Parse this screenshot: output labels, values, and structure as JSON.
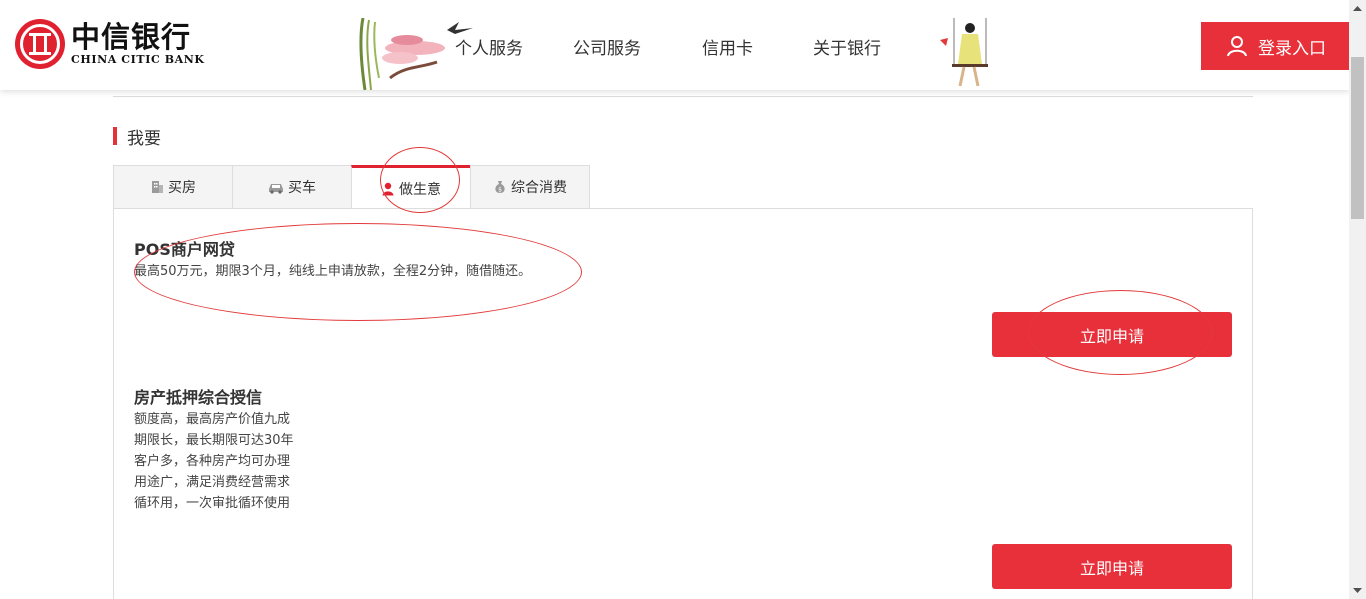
{
  "header": {
    "logo": {
      "cn": "中信银行",
      "en": "CHINA CITIC BANK"
    },
    "nav": [
      "个人服务",
      "公司服务",
      "信用卡",
      "关于银行"
    ],
    "login_label": "登录入口"
  },
  "section": {
    "title": "我要"
  },
  "tabs": [
    {
      "label": "买房",
      "icon": "building-icon"
    },
    {
      "label": "买车",
      "icon": "car-icon"
    },
    {
      "label": "做生意",
      "icon": "person-icon",
      "active": true
    },
    {
      "label": "综合消费",
      "icon": "money-bag-icon"
    }
  ],
  "products": [
    {
      "title": "POS商户网贷",
      "desc": [
        "最高50万元，期限3个月，纯线上申请放款，全程2分钟，随借随还。"
      ],
      "button": "立即申请"
    },
    {
      "title": "房产抵押综合授信",
      "desc": [
        "额度高，最高房产价值九成",
        "期限长，最长期限可达30年",
        "客户多，各种房产均可办理",
        "用途广，满足消费经营需求",
        "循环用，一次审批循环使用"
      ],
      "button": "立即申请"
    }
  ],
  "colors": {
    "accent": "#e8303b",
    "annotation": "#e23a3a"
  }
}
